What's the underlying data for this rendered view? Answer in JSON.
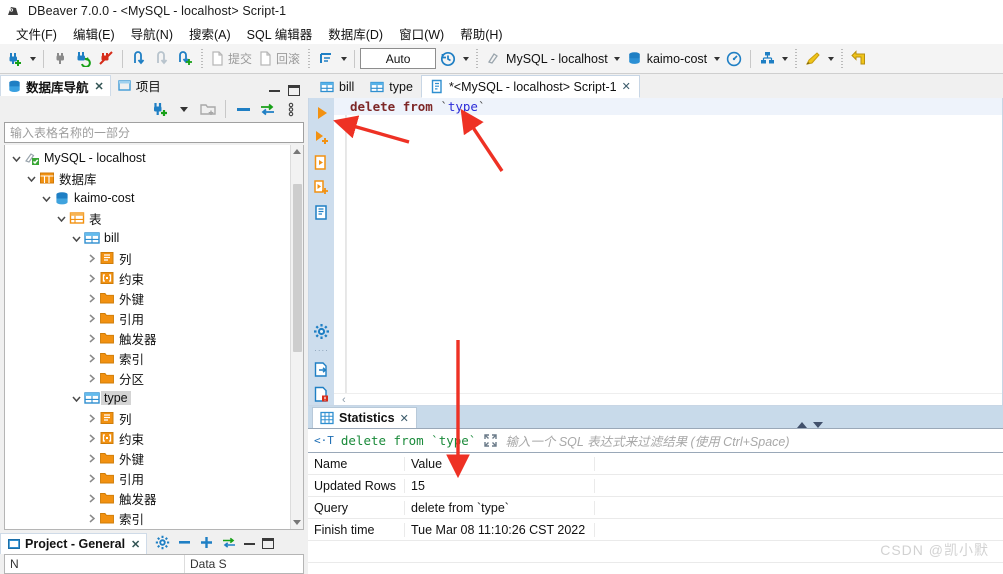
{
  "window": {
    "title": "DBeaver 7.0.0 - <MySQL - localhost> Script-1",
    "app_icon": "dbeaver-icon"
  },
  "menubar": {
    "items": [
      {
        "label": "文件(F)",
        "name": "menu-file"
      },
      {
        "label": "编辑(E)",
        "name": "menu-edit"
      },
      {
        "label": "导航(N)",
        "name": "menu-navigate"
      },
      {
        "label": "搜索(A)",
        "name": "menu-search"
      },
      {
        "label": "SQL 编辑器",
        "name": "menu-sql-editor"
      },
      {
        "label": "数据库(D)",
        "name": "menu-database"
      },
      {
        "label": "窗口(W)",
        "name": "menu-window"
      },
      {
        "label": "帮助(H)",
        "name": "menu-help"
      }
    ]
  },
  "toolbar": {
    "commit_label": "提交",
    "rollback_label": "回滚",
    "auto_label": "Auto",
    "connection_label": "MySQL - localhost",
    "database_label": "kaimo-cost"
  },
  "sidebar": {
    "tabs": [
      {
        "label": "数据库导航",
        "name": "view-tab-database-navigator",
        "active": true,
        "closable": true
      },
      {
        "label": "项目",
        "name": "view-tab-projects",
        "active": false,
        "closable": false
      }
    ],
    "filter_placeholder": "输入表格名称的一部分",
    "tree": [
      {
        "label": "MySQL - localhost",
        "depth": 0,
        "icon": "connection-icon",
        "twist": "down",
        "selected": false
      },
      {
        "label": "数据库",
        "depth": 1,
        "icon": "databases-folder-icon",
        "twist": "down",
        "selected": false
      },
      {
        "label": "kaimo-cost",
        "depth": 2,
        "icon": "database-icon",
        "twist": "down",
        "selected": false
      },
      {
        "label": "表",
        "depth": 3,
        "icon": "tables-folder-icon",
        "twist": "down",
        "selected": false
      },
      {
        "label": "bill",
        "depth": 4,
        "icon": "table-icon",
        "twist": "down",
        "selected": false
      },
      {
        "label": "列",
        "depth": 5,
        "icon": "columns-icon",
        "twist": "right",
        "selected": false
      },
      {
        "label": "约束",
        "depth": 5,
        "icon": "constraints-icon",
        "twist": "right",
        "selected": false
      },
      {
        "label": "外键",
        "depth": 5,
        "icon": "folder-icon",
        "twist": "right",
        "selected": false
      },
      {
        "label": "引用",
        "depth": 5,
        "icon": "folder-icon",
        "twist": "right",
        "selected": false
      },
      {
        "label": "触发器",
        "depth": 5,
        "icon": "folder-icon",
        "twist": "right",
        "selected": false
      },
      {
        "label": "索引",
        "depth": 5,
        "icon": "folder-icon",
        "twist": "right",
        "selected": false
      },
      {
        "label": "分区",
        "depth": 5,
        "icon": "folder-icon",
        "twist": "right",
        "selected": false
      },
      {
        "label": "type",
        "depth": 4,
        "icon": "table-icon",
        "twist": "down",
        "selected": true
      },
      {
        "label": "列",
        "depth": 5,
        "icon": "columns-icon",
        "twist": "right",
        "selected": false
      },
      {
        "label": "约束",
        "depth": 5,
        "icon": "constraints-icon",
        "twist": "right",
        "selected": false
      },
      {
        "label": "外键",
        "depth": 5,
        "icon": "folder-icon",
        "twist": "right",
        "selected": false
      },
      {
        "label": "引用",
        "depth": 5,
        "icon": "folder-icon",
        "twist": "right",
        "selected": false
      },
      {
        "label": "触发器",
        "depth": 5,
        "icon": "folder-icon",
        "twist": "right",
        "selected": false
      },
      {
        "label": "索引",
        "depth": 5,
        "icon": "folder-icon",
        "twist": "right",
        "selected": false
      }
    ]
  },
  "project_panel": {
    "tab_label": "Project - General",
    "col1": "N",
    "col2": "Data S"
  },
  "editor": {
    "tabs": [
      {
        "label": "bill",
        "name": "editor-tab-bill",
        "icon": "table-icon",
        "active": false,
        "closable": false
      },
      {
        "label": "type",
        "name": "editor-tab-type",
        "icon": "table-icon",
        "active": false,
        "closable": false
      },
      {
        "label": "*<MySQL - localhost> Script-1",
        "name": "editor-tab-script-1",
        "icon": "sql-script-icon",
        "active": true,
        "closable": true
      }
    ],
    "sql": {
      "keyword1": "delete",
      "keyword2": "from",
      "backtick_open": "`",
      "identifier": "type",
      "backtick_close": "`"
    }
  },
  "results": {
    "tab_label": "Statistics",
    "filter_query": "delete from `type`",
    "filter_placeholder": "输入一个 SQL 表达式来过滤结果 (使用 Ctrl+Space)",
    "columns": [
      "Name",
      "Value"
    ],
    "rows": [
      {
        "name": "Updated Rows",
        "value": "15"
      },
      {
        "name": "Query",
        "value": "delete from `type`"
      },
      {
        "name": "Finish time",
        "value": "Tue Mar 08 11:10:26 CST 2022"
      }
    ]
  },
  "watermark": "CSDN @凯小默",
  "colors": {
    "accent_blue": "#1f7fc4",
    "orange": "#f29111",
    "annotation_red": "#ee3124",
    "sql_keyword": "#7d2727",
    "sql_identifier": "#2c2cd8",
    "filter_query_green": "#1a8a3a"
  }
}
